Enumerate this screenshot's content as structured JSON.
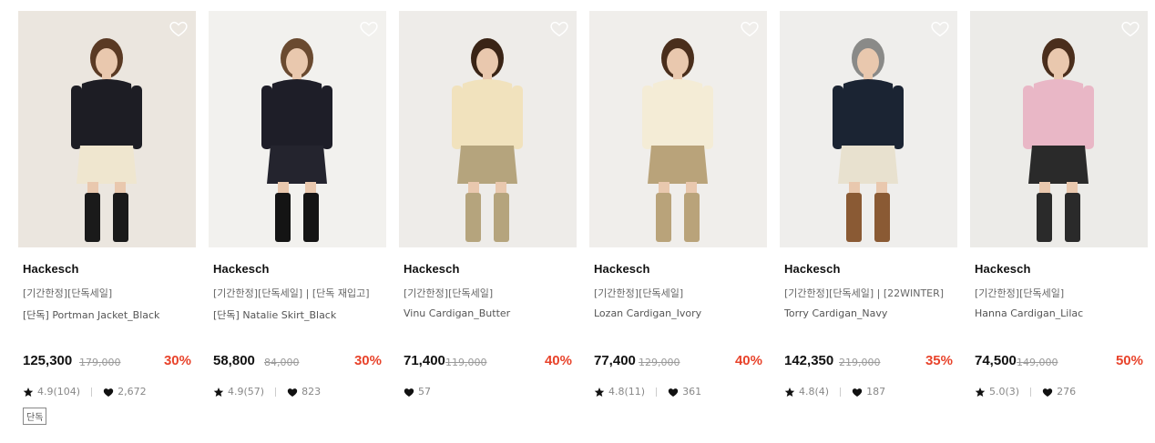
{
  "products": [
    {
      "brand": "Hackesch",
      "promo": "[기간한정][단독세일]",
      "name": "[단독] Portman Jacket_Black",
      "price": "125,300",
      "original": "179,000",
      "discount": "30%",
      "rating": "4.9(104)",
      "likes": "2,672",
      "badge": "단독",
      "colors": {
        "bg": "#ebe6df",
        "top": "#1d1d24",
        "bottom": "#efe6cf",
        "boots": "#1a1a1a",
        "hair": "#5a3a24"
      }
    },
    {
      "brand": "Hackesch",
      "promo": "[기간한정][단독세일] | [단독 재입고]",
      "name": "[단독] Natalie Skirt_Black",
      "price": "58,800",
      "original": "84,000",
      "discount": "30%",
      "rating": "4.9(57)",
      "likes": "823",
      "colors": {
        "bg": "#f2f1ee",
        "top": "#1e1e28",
        "bottom": "#24242e",
        "boots": "#141414",
        "hair": "#6a4a30"
      }
    },
    {
      "brand": "Hackesch",
      "promo": "[기간한정][단독세일]",
      "name": "Vinu Cardigan_Butter",
      "price": "71,400",
      "original": "119,000",
      "discount": "40%",
      "likes": "57",
      "colors": {
        "bg": "#eeece9",
        "top": "#f1e2bd",
        "bottom": "#b5a47d",
        "boots": "#b5a47d",
        "hair": "#3a2416"
      }
    },
    {
      "brand": "Hackesch",
      "promo": "[기간한정][단독세일]",
      "name": "Lozan Cardigan_Ivory",
      "price": "77,400",
      "original": "129,000",
      "discount": "40%",
      "rating": "4.8(11)",
      "likes": "361",
      "colors": {
        "bg": "#f0eeeb",
        "top": "#f4ecd6",
        "bottom": "#b9a37a",
        "boots": "#b9a37a",
        "hair": "#4a2e1c"
      }
    },
    {
      "brand": "Hackesch",
      "promo": "[기간한정][단독세일] | [22WINTER]",
      "name": "Torry Cardigan_Navy",
      "price": "142,350",
      "original": "219,000",
      "discount": "35%",
      "rating": "4.8(4)",
      "likes": "187",
      "colors": {
        "bg": "#efeeec",
        "top": "#1b2433",
        "bottom": "#e8e1cf",
        "boots": "#8a5a34",
        "hair": "#8a8a88"
      }
    },
    {
      "brand": "Hackesch",
      "promo": "[기간한정][단독세일]",
      "name": "Hanna Cardigan_Lilac",
      "price": "74,500",
      "original": "149,000",
      "discount": "50%",
      "rating": "5.0(3)",
      "likes": "276",
      "colors": {
        "bg": "#ecebe8",
        "top": "#e9b7c6",
        "bottom": "#2a2a2a",
        "boots": "#2a2a2a",
        "hair": "#4a2e1c"
      }
    }
  ]
}
